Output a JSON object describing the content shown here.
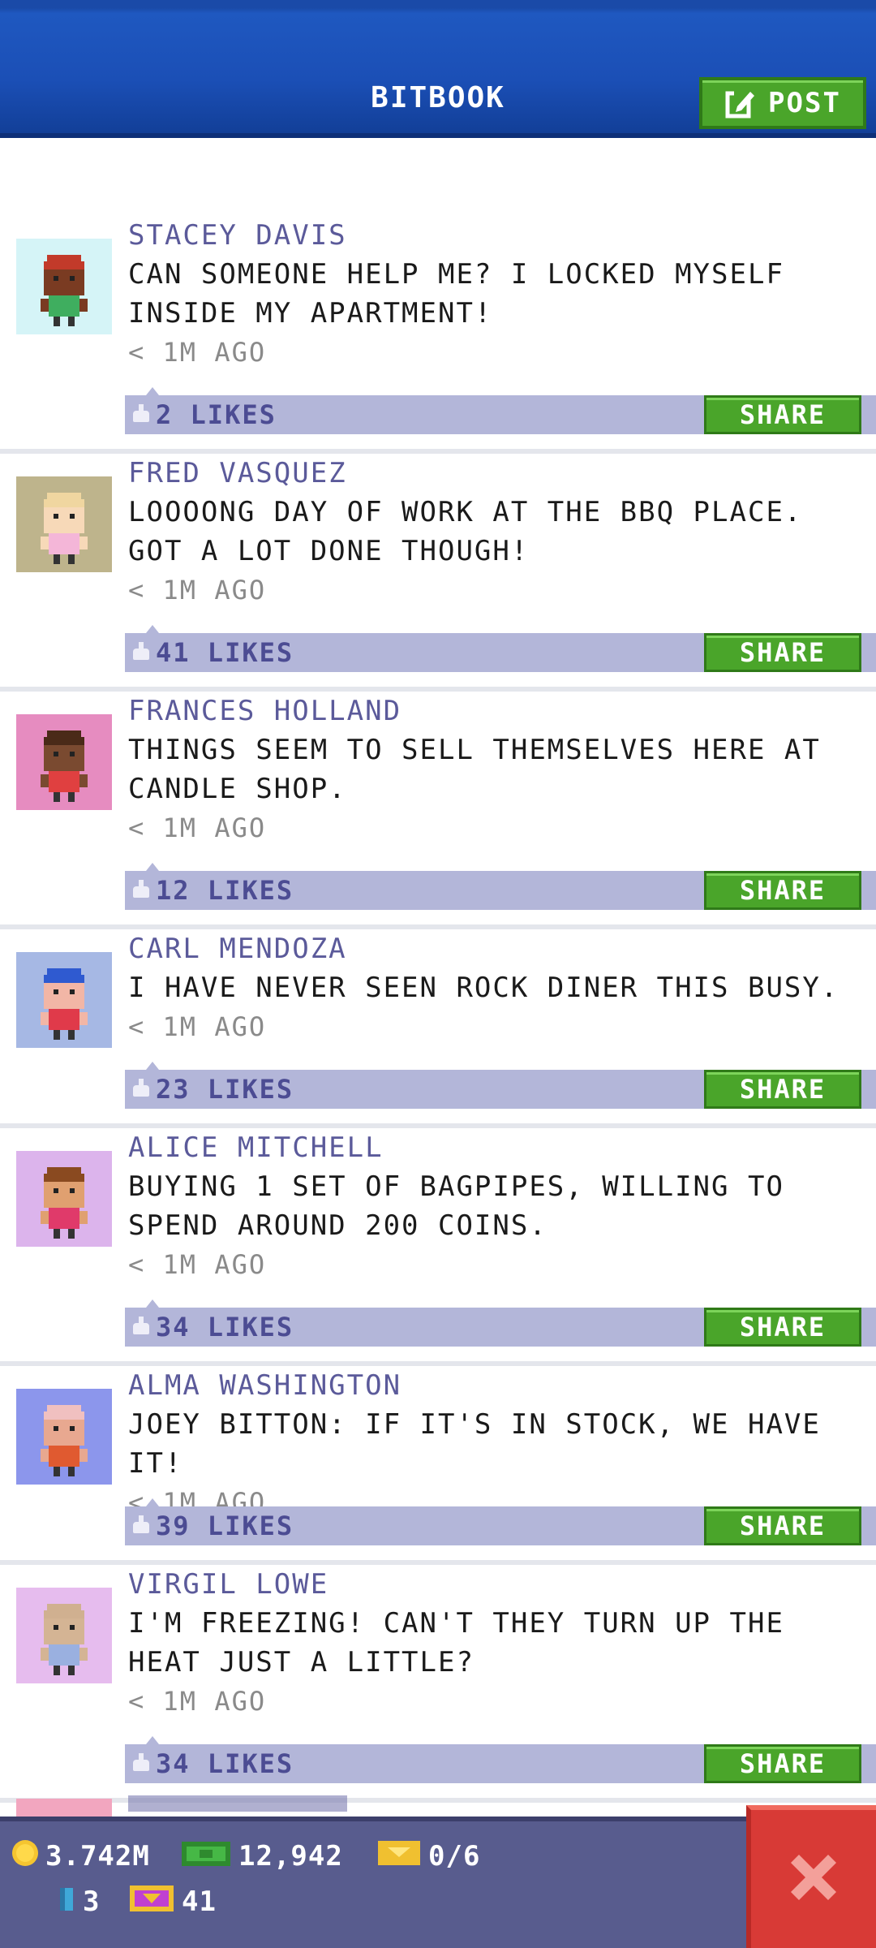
{
  "header": {
    "title": "BITBOOK",
    "post_label": "POST"
  },
  "posts": [
    {
      "name": "STACEY DAVIS",
      "message": "CAN SOMEONE HELP ME? I LOCKED MYSELF INSIDE MY APARTMENT!",
      "time": "< 1M AGO",
      "likes": "2 LIKES",
      "share": "SHARE",
      "avatar_bg": "#d5f4f7",
      "hair": "#c23a2a",
      "skin": "#7a3b22",
      "shirt": "#3fae5f"
    },
    {
      "name": "FRED VASQUEZ",
      "message": "LOOOONG DAY OF WORK AT THE BBQ PLACE. GOT A LOT DONE THOUGH!",
      "time": "< 1M AGO",
      "likes": "41 LIKES",
      "share": "SHARE",
      "avatar_bg": "#beb48c",
      "hair": "#f0d6a0",
      "skin": "#f7d9b8",
      "shirt": "#f4b6d8"
    },
    {
      "name": "FRANCES HOLLAND",
      "message": "THINGS SEEM TO SELL THEMSELVES HERE AT CANDLE SHOP.",
      "time": "< 1M AGO",
      "likes": "12 LIKES",
      "share": "SHARE",
      "avatar_bg": "#e68cc0",
      "hair": "#4a2a18",
      "skin": "#7a4a30",
      "shirt": "#e04040"
    },
    {
      "name": "CARL MENDOZA",
      "message": "I HAVE NEVER SEEN ROCK DINER THIS BUSY.",
      "time": "< 1M AGO",
      "likes": "23 LIKES",
      "share": "SHARE",
      "avatar_bg": "#a6b8e4",
      "hair": "#2f5ad0",
      "skin": "#f2b6a6",
      "shirt": "#e03a4a"
    },
    {
      "name": "ALICE MITCHELL",
      "message": "BUYING 1 SET OF BAGPIPES, WILLING TO SPEND AROUND 200 COINS.",
      "time": "< 1M AGO",
      "likes": "34 LIKES",
      "share": "SHARE",
      "avatar_bg": "#dcb4ec",
      "hair": "#8a4a20",
      "skin": "#e0a070",
      "shirt": "#e03a6a"
    },
    {
      "name": "ALMA WASHINGTON",
      "message": "JOEY BITTON: IF IT'S IN STOCK, WE HAVE IT!",
      "time": "< 1M AGO",
      "likes": "39 LIKES",
      "share": "SHARE",
      "avatar_bg": "#8c96ec",
      "hair": "#f0c0c0",
      "skin": "#e8a890",
      "shirt": "#e05a30"
    },
    {
      "name": "VIRGIL LOWE",
      "message": "I'M FREEZING! CAN'T THEY TURN UP THE HEAT JUST A LITTLE?",
      "time": "< 1M AGO",
      "likes": "34 LIKES",
      "share": "SHARE",
      "avatar_bg": "#e6bcee",
      "hair": "#d0b090",
      "skin": "#d4b494",
      "shirt": "#9ab0e0"
    }
  ],
  "hud": {
    "coins": "3.742M",
    "bux": "12,942",
    "tickets": "0/6",
    "keys": "3",
    "vip": "41"
  },
  "colors": {
    "accent": "#4aa52a",
    "header": "#1b4fb6",
    "like_bar": "#b3b6d9",
    "close": "#d83a36"
  }
}
